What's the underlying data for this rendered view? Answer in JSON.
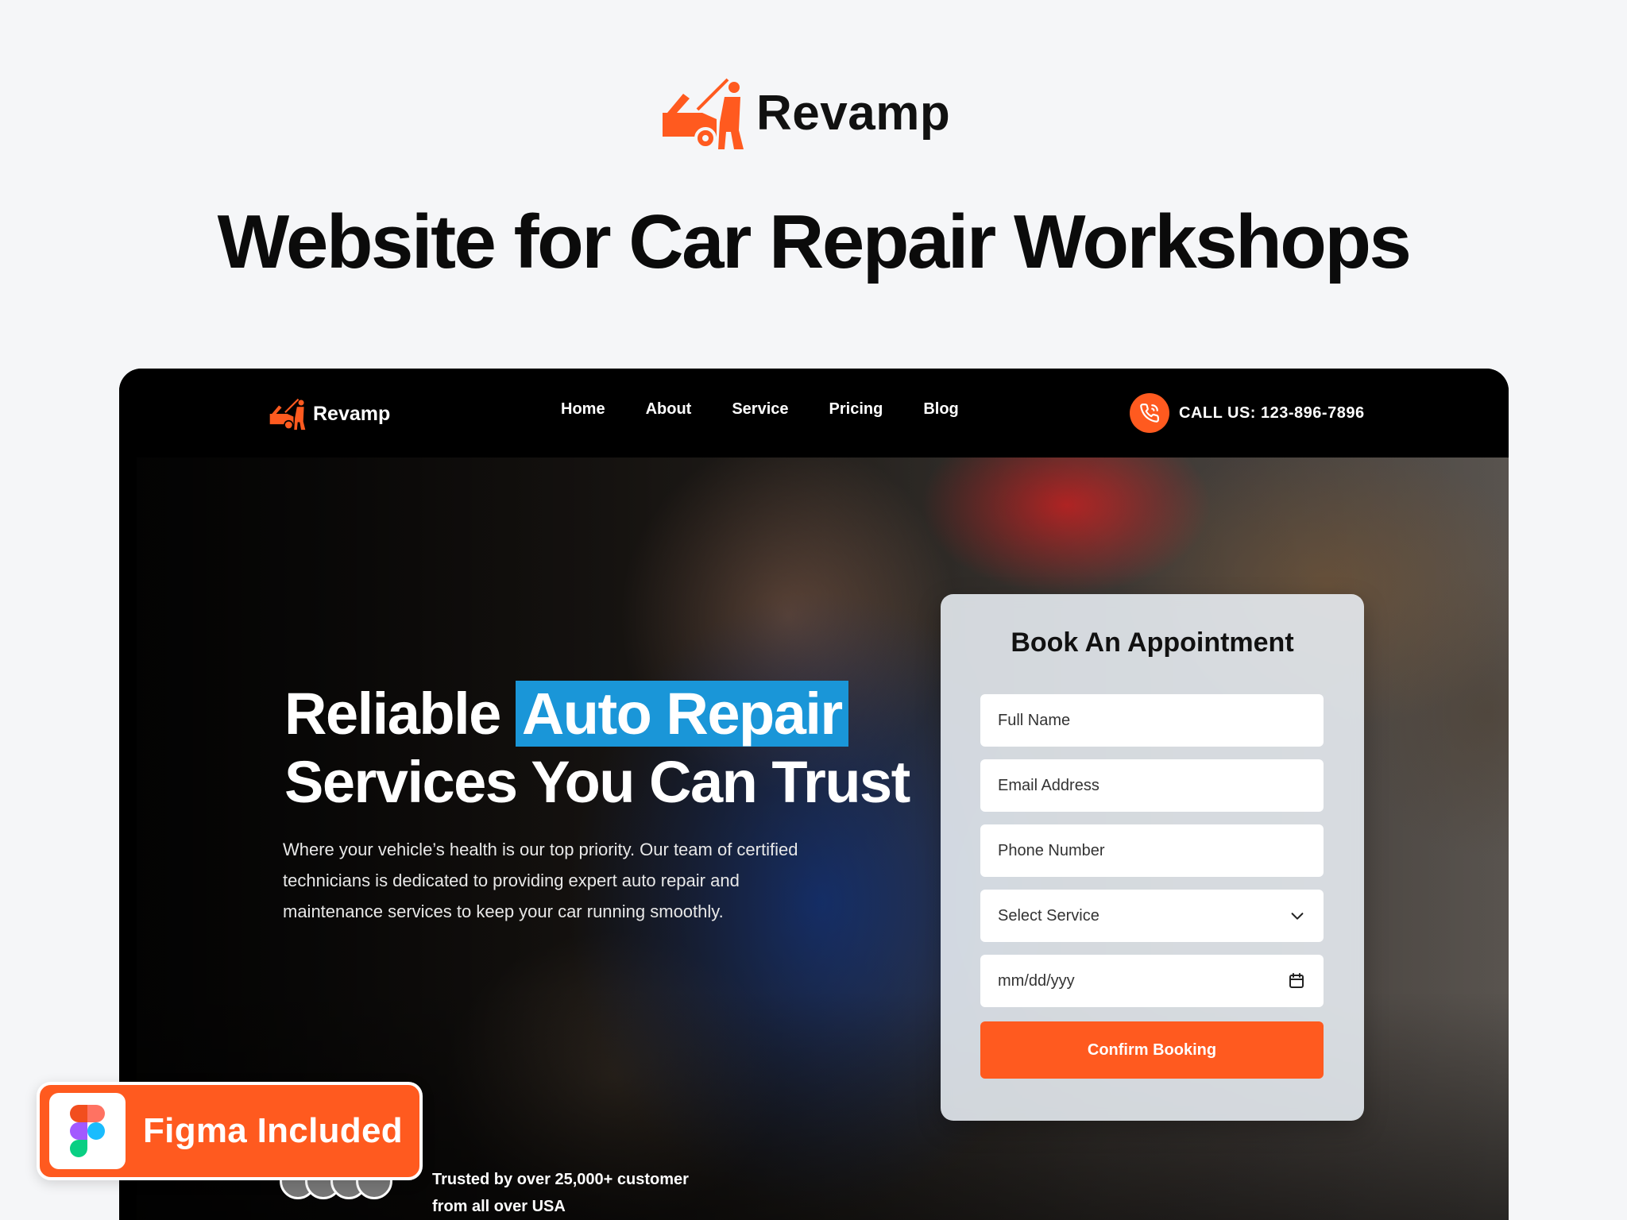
{
  "brand": {
    "name": "Revamp",
    "accent_color": "#ff5a1f",
    "highlight_color": "#1a96d8"
  },
  "headline": "Website for Car Repair Workshops",
  "site": {
    "nav": {
      "logo_text": "Revamp",
      "links": [
        {
          "label": "Home"
        },
        {
          "label": "About"
        },
        {
          "label": "Service"
        },
        {
          "label": "Pricing"
        },
        {
          "label": "Blog"
        }
      ],
      "call_label": "CALL US: 123-896-7896",
      "call_icon": "phone-icon"
    },
    "hero": {
      "title_line1_plain": "Reliable",
      "title_line1_highlight": "Auto Repair",
      "title_line2": "Services You Can Trust",
      "description_lines": [
        "Where your vehicle’s health is our top priority. Our team of certified",
        "technicians is dedicated to providing expert auto repair and",
        "maintenance services to keep your car running smoothly."
      ],
      "trusted_lines": [
        "Trusted by over 25,000+ customer",
        "from all over USA"
      ]
    },
    "booking": {
      "title": "Book An Appointment",
      "fields": {
        "full_name_placeholder": "Full Name",
        "email_placeholder": "Email Address",
        "phone_placeholder": "Phone Number",
        "service_selected": "Select Service",
        "date_placeholder": "mm/dd/yyy"
      },
      "submit_label": "Confirm Booking"
    }
  },
  "badge": {
    "label": "Figma Included"
  }
}
